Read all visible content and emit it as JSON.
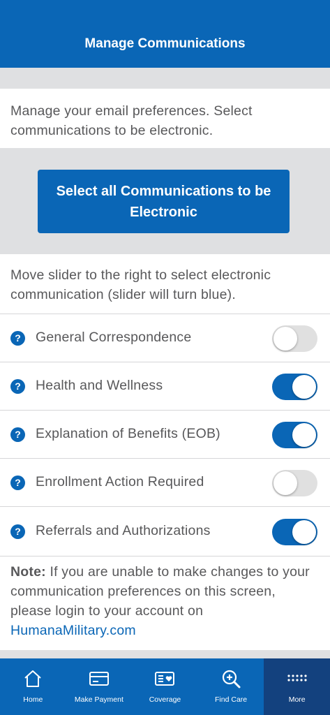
{
  "header": {
    "title": "Manage Communications"
  },
  "intro": {
    "text": "Manage your email preferences. Select communications to be electronic."
  },
  "select_all": {
    "label": "Select all Communications to be Electronic"
  },
  "instructions": {
    "text": "Move slider to the right to select electronic communication (slider will turn blue)."
  },
  "preferences": [
    {
      "label": "General Correspondence",
      "enabled": false
    },
    {
      "label": "Health and Wellness",
      "enabled": true
    },
    {
      "label": "Explanation of Benefits (EOB)",
      "enabled": true
    },
    {
      "label": "Enrollment Action Required",
      "enabled": false
    },
    {
      "label": "Referrals and Authorizations",
      "enabled": true
    }
  ],
  "help_glyph": "?",
  "note": {
    "prefix": "Note:",
    "text": " If you are unable to make changes to your communication preferences on this screen, please login to your account on ",
    "link": "HumanaMilitary.com"
  },
  "tabs": [
    {
      "label": "Home",
      "icon": "home-icon",
      "active": false
    },
    {
      "label": "Make Payment",
      "icon": "credit-card-icon",
      "active": false
    },
    {
      "label": "Coverage",
      "icon": "id-card-icon",
      "active": false
    },
    {
      "label": "Find Care",
      "icon": "search-icon",
      "active": false
    },
    {
      "label": "More",
      "icon": "dots-grid-icon",
      "active": true
    }
  ],
  "colors": {
    "brand": "#0a66b6",
    "active_tab": "#13417e",
    "toggle_off": "#e0e0e0",
    "band": "#dfe0e2",
    "text": "#58585a"
  }
}
